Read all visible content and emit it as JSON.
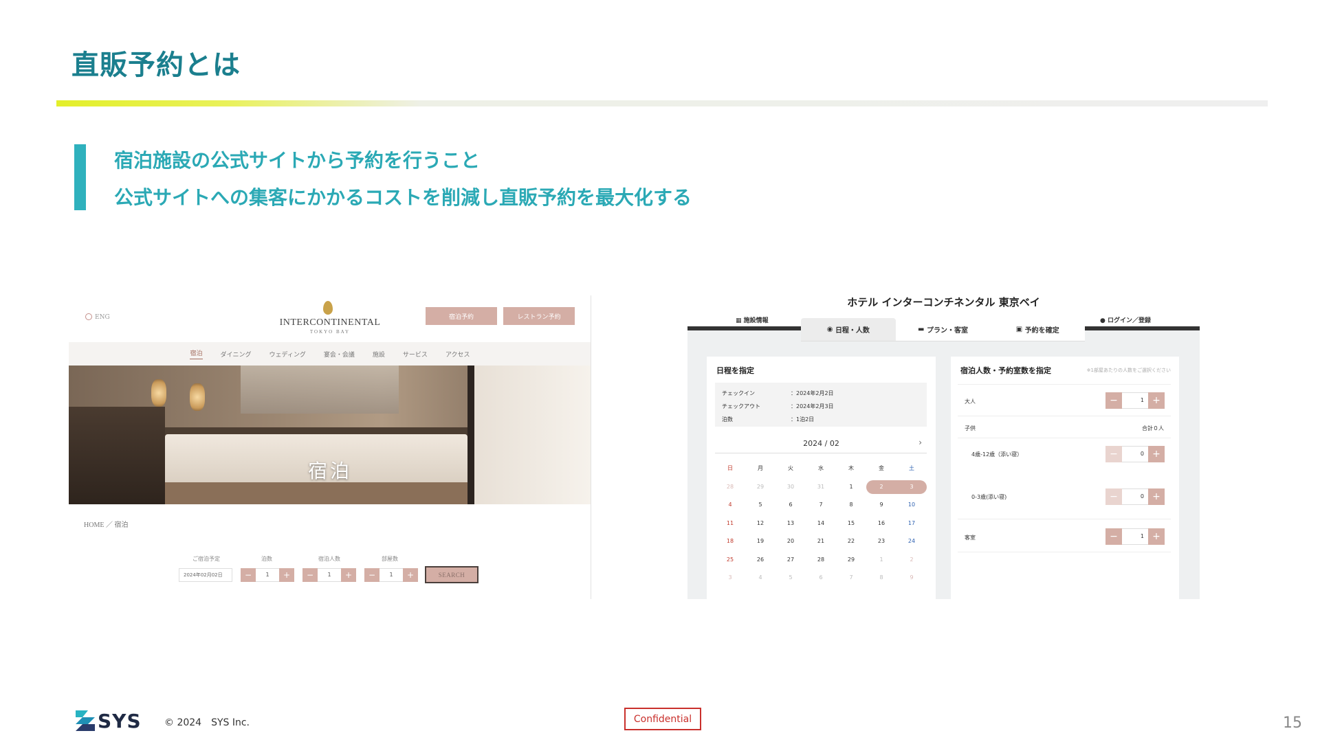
{
  "slide": {
    "title": "直販予約とは",
    "callout_line1": "宿泊施設の公式サイトから予約を行うこと",
    "callout_line2": "公式サイトへの集客にかかるコストを削減し直販予約を最大化する"
  },
  "left_screenshot": {
    "lang": "ENG",
    "logo_text": "INTERCONTINENTAL",
    "logo_sub": "TOKYO BAY",
    "btn_stay": "宿泊予約",
    "btn_restaurant": "レストラン予約",
    "nav": [
      "宿泊",
      "ダイニング",
      "ウェディング",
      "宴会・会議",
      "施設",
      "サービス",
      "アクセス"
    ],
    "hero_title": "宿泊",
    "breadcrumb": "HOME ／ 宿泊",
    "search": {
      "date_label": "ご宿泊予定",
      "date_value": "2024年02月02日",
      "nights_label": "泊数",
      "nights_value": "1",
      "guests_label": "宿泊人数",
      "guests_value": "1",
      "rooms_label": "部屋数",
      "rooms_value": "1",
      "search_label": "SEARCH",
      "minus": "−",
      "plus": "+"
    }
  },
  "right_screenshot": {
    "hotel_name": "ホテル インターコンチネンタル 東京ベイ",
    "tab_left": "施設情報",
    "tab_right": "ログイン／登録",
    "steps": [
      "日程・人数",
      "プラン・客室",
      "予約を確定"
    ],
    "schedule": {
      "title": "日程を指定",
      "checkin_label": "チェックイン",
      "checkin_value": "：2024年2月2日",
      "checkout_label": "チェックアウト",
      "checkout_value": "：2024年2月3日",
      "nights_label": "泊数",
      "nights_value": "：1泊2日",
      "month": "2024 / 02",
      "next": "›",
      "weekdays": [
        "日",
        "月",
        "火",
        "水",
        "木",
        "金",
        "土"
      ],
      "days": [
        "28",
        "29",
        "30",
        "31",
        "1",
        "2",
        "3",
        "4",
        "5",
        "6",
        "7",
        "8",
        "9",
        "10",
        "11",
        "12",
        "13",
        "14",
        "15",
        "16",
        "17",
        "18",
        "19",
        "20",
        "21",
        "22",
        "23",
        "24",
        "25",
        "26",
        "27",
        "28",
        "29",
        "1",
        "2",
        "3",
        "4",
        "5",
        "6",
        "7",
        "8",
        "9"
      ]
    },
    "guests": {
      "title": "宿泊人数・予約室数を指定",
      "hint": "※1部屋あたりの人数をご選択ください",
      "adult_label": "大人",
      "adult_value": "1",
      "child_label": "子供",
      "child_total": "合計０人",
      "child1_label": "4歳-12歳（添い寝）",
      "child1_value": "0",
      "child2_label": "0-3歳(添い寝)",
      "child2_value": "0",
      "rooms_label": "客室",
      "rooms_value": "1",
      "minus": "−",
      "plus": "+"
    }
  },
  "footer": {
    "logo_word": "SYS",
    "copyright": "©  2024　SYS Inc.",
    "confidential": "Confidential",
    "page_number": "15"
  },
  "colors": {
    "title": "#1b7f8e",
    "accent": "#2fb1bd",
    "lime": "#e3ef2a",
    "pink": "#d4aea5",
    "confidential": "#c9302c"
  }
}
